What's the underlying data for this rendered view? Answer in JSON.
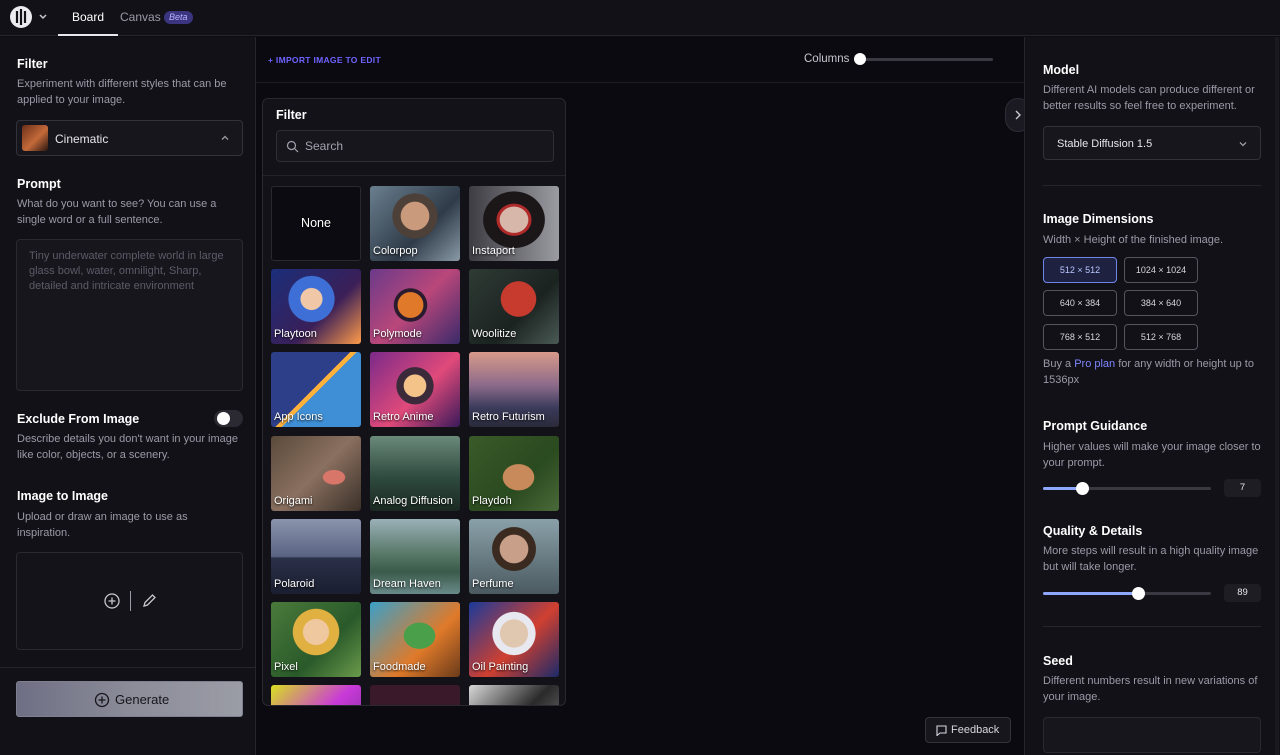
{
  "topbar": {
    "tabs": [
      {
        "label": "Board"
      },
      {
        "label": "Canvas"
      }
    ],
    "beta_badge": "Beta"
  },
  "left": {
    "filter": {
      "title": "Filter",
      "description": "Experiment with different styles that can be applied to your image.",
      "selected": "Cinematic"
    },
    "prompt": {
      "title": "Prompt",
      "description": "What do you want to see? You can use a single word or a full sentence.",
      "placeholder": "Tiny underwater complete world in large glass bowl, water, omnilight, Sharp, detailed and intricate environment"
    },
    "exclude": {
      "title": "Exclude From Image",
      "description": "Describe details you don't want in your image like color, objects, or a scenery.",
      "enabled": false
    },
    "img2img": {
      "title": "Image to Image",
      "description": "Upload or draw an image to use as inspiration."
    },
    "generate_label": "Generate"
  },
  "center": {
    "import_label": "+ IMPORT IMAGE TO EDIT",
    "columns_label": "Columns",
    "feedback_label": "Feedback"
  },
  "filter_popover": {
    "title": "Filter",
    "search_placeholder": "Search",
    "items": [
      {
        "label": "None"
      },
      {
        "label": "Colorpop"
      },
      {
        "label": "Instaport"
      },
      {
        "label": "Playtoon"
      },
      {
        "label": "Polymode"
      },
      {
        "label": "Woolitize"
      },
      {
        "label": "App Icons"
      },
      {
        "label": "Retro Anime"
      },
      {
        "label": "Retro Futurism"
      },
      {
        "label": "Origami"
      },
      {
        "label": "Analog Diffusion"
      },
      {
        "label": "Playdoh"
      },
      {
        "label": "Polaroid"
      },
      {
        "label": "Dream Haven"
      },
      {
        "label": "Perfume"
      },
      {
        "label": "Pixel"
      },
      {
        "label": "Foodmade"
      },
      {
        "label": "Oil Painting"
      },
      {
        "label": ""
      },
      {
        "label": ""
      },
      {
        "label": ""
      }
    ]
  },
  "right": {
    "model": {
      "title": "Model",
      "description": "Different AI models can produce different or better results so feel free to experiment.",
      "selected": "Stable Diffusion 1.5"
    },
    "dimensions": {
      "title": "Image Dimensions",
      "description": "Width × Height of the finished image.",
      "options": [
        "512 × 512",
        "1024 × 1024",
        "640 × 384",
        "384 × 640",
        "768 × 512",
        "512 × 768"
      ],
      "selected": "512 × 512",
      "note_pre": "Buy a ",
      "note_link": "Pro plan",
      "note_post": " for any width or height up to 1536px"
    },
    "guidance": {
      "title": "Prompt Guidance",
      "description": "Higher values will make your image closer to your prompt.",
      "value": "7"
    },
    "quality": {
      "title": "Quality & Details",
      "description": "More steps will result in a high quality image but will take longer.",
      "value": "89"
    },
    "seed": {
      "title": "Seed",
      "description": "Different numbers result in new variations of your image."
    }
  }
}
